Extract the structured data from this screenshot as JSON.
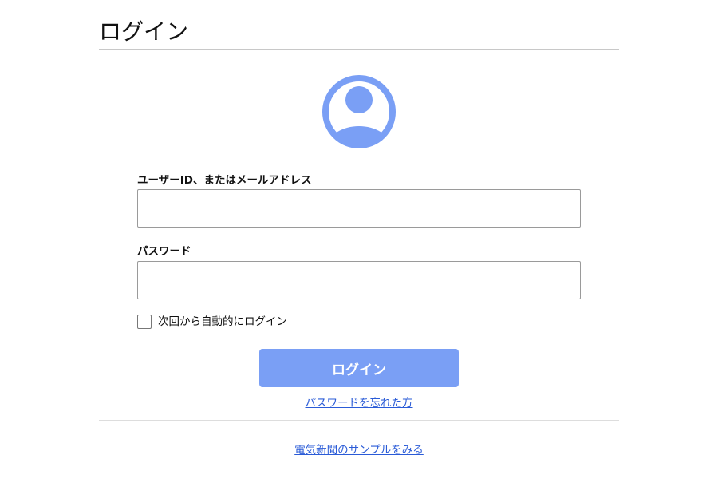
{
  "page": {
    "title": "ログイン"
  },
  "avatar": {
    "icon": "user-avatar-icon",
    "color": "#7a9ff5"
  },
  "form": {
    "userid_label": "ユーザーID、またはメールアドレス",
    "userid_value": "",
    "password_label": "パスワード",
    "password_value": "",
    "remember_label": "次回から自動的にログイン",
    "remember_checked": false,
    "submit_label": "ログイン",
    "submit_color": "#7a9ff5"
  },
  "links": {
    "forgot_password": "パスワードを忘れた方",
    "sample": "電気新聞のサンプルをみる",
    "link_color": "#2a5bd7"
  }
}
